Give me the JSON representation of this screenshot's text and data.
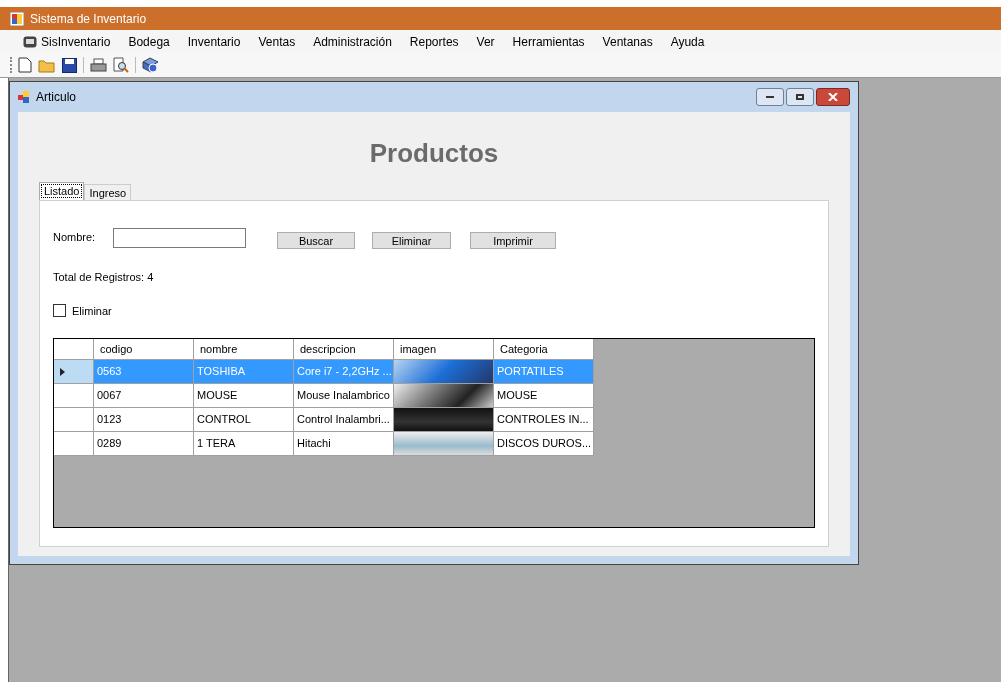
{
  "app": {
    "title": "Sistema de Inventario"
  },
  "menu": [
    "SisInventario",
    "Bodega",
    "Inventario",
    "Ventas",
    "Administración",
    "Reportes",
    "Ver",
    "Herramientas",
    "Ventanas",
    "Ayuda"
  ],
  "child_window": {
    "title": "Articulo"
  },
  "heading": "Productos",
  "tabs": [
    {
      "label": "Listado",
      "selected": true
    },
    {
      "label": "Ingreso",
      "selected": false
    }
  ],
  "form": {
    "name_label": "Nombre:",
    "buttons": [
      "Buscar",
      "Eliminar",
      "Imprimir"
    ],
    "total": "Total de Registros: 4",
    "delete_checkbox": {
      "label": "Eliminar",
      "checked": false
    }
  },
  "table": {
    "columns": [
      "codigo",
      "nombre",
      "descripcion",
      "imagen",
      "Categoria"
    ],
    "rows": [
      {
        "selected": true,
        "cells": [
          "0563",
          "TOSHIBA",
          "Core i7 - 2,2GHz ...",
          "",
          "PORTATILES"
        ]
      },
      {
        "selected": false,
        "cells": [
          "0067",
          "MOUSE",
          "Mouse Inalambrico",
          "",
          "MOUSE"
        ]
      },
      {
        "selected": false,
        "cells": [
          "0123",
          "CONTROL",
          "Control Inalambri...",
          "",
          "CONTROLES IN..."
        ]
      },
      {
        "selected": false,
        "cells": [
          "0289",
          "1 TERA",
          "Hitachi",
          "",
          "DISCOS DUROS..."
        ]
      }
    ]
  }
}
